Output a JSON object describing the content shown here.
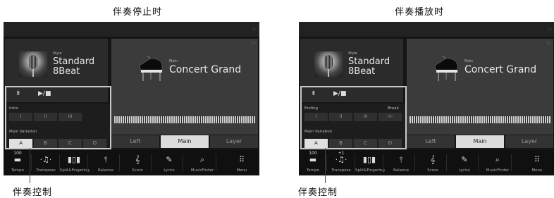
{
  "captions": {
    "left": "伴奏停止时",
    "right": "伴奏播放时"
  },
  "callouts": {
    "left": "伴奏控制",
    "right": "伴奏控制"
  },
  "style": {
    "category": "Style",
    "name_line1": "Standard",
    "name_line2": "8Beat"
  },
  "voice": {
    "category": "Main",
    "name": "Concert Grand"
  },
  "part_tabs": [
    "Left",
    "Main",
    "Layer"
  ],
  "controls": {
    "sync_start": "⇟",
    "start_stop": "▶/■"
  },
  "sections": {
    "left_label": "Intro",
    "right_left_label": "Ending",
    "right_right_label": "Break",
    "buttons": [
      "I",
      "II",
      "III"
    ],
    "break_icon": "⊣⊢",
    "variation_label": "Main Variation",
    "variations": [
      "A",
      "B",
      "C",
      "D"
    ]
  },
  "bottom_bar": [
    {
      "top": "100",
      "icon": "▬",
      "label": "Tempo"
    },
    {
      "top": "",
      "icon": "·♫·",
      "label": "Transpose"
    },
    {
      "top": "",
      "icon": "▮▯▮",
      "label": "Split&Fingering"
    },
    {
      "top": "",
      "icon": "⫯",
      "label": "Balance"
    },
    {
      "top": "",
      "icon": "𝄞",
      "label": "Score"
    },
    {
      "top": "",
      "icon": "✎",
      "label": "Lyrics"
    },
    {
      "top": "",
      "icon": "⌕",
      "label": "MusicFinder"
    },
    {
      "top": "",
      "icon": "⠿",
      "label": "Menu"
    }
  ],
  "bottom_bar_right_transpose_top": "+1",
  "icons": {
    "corner_arrow": "▷",
    "selected_tab": "Main",
    "selected_variation": "A"
  },
  "colors": {
    "screen_bg": "#151515",
    "highlight_border": "#c8c8c8"
  }
}
